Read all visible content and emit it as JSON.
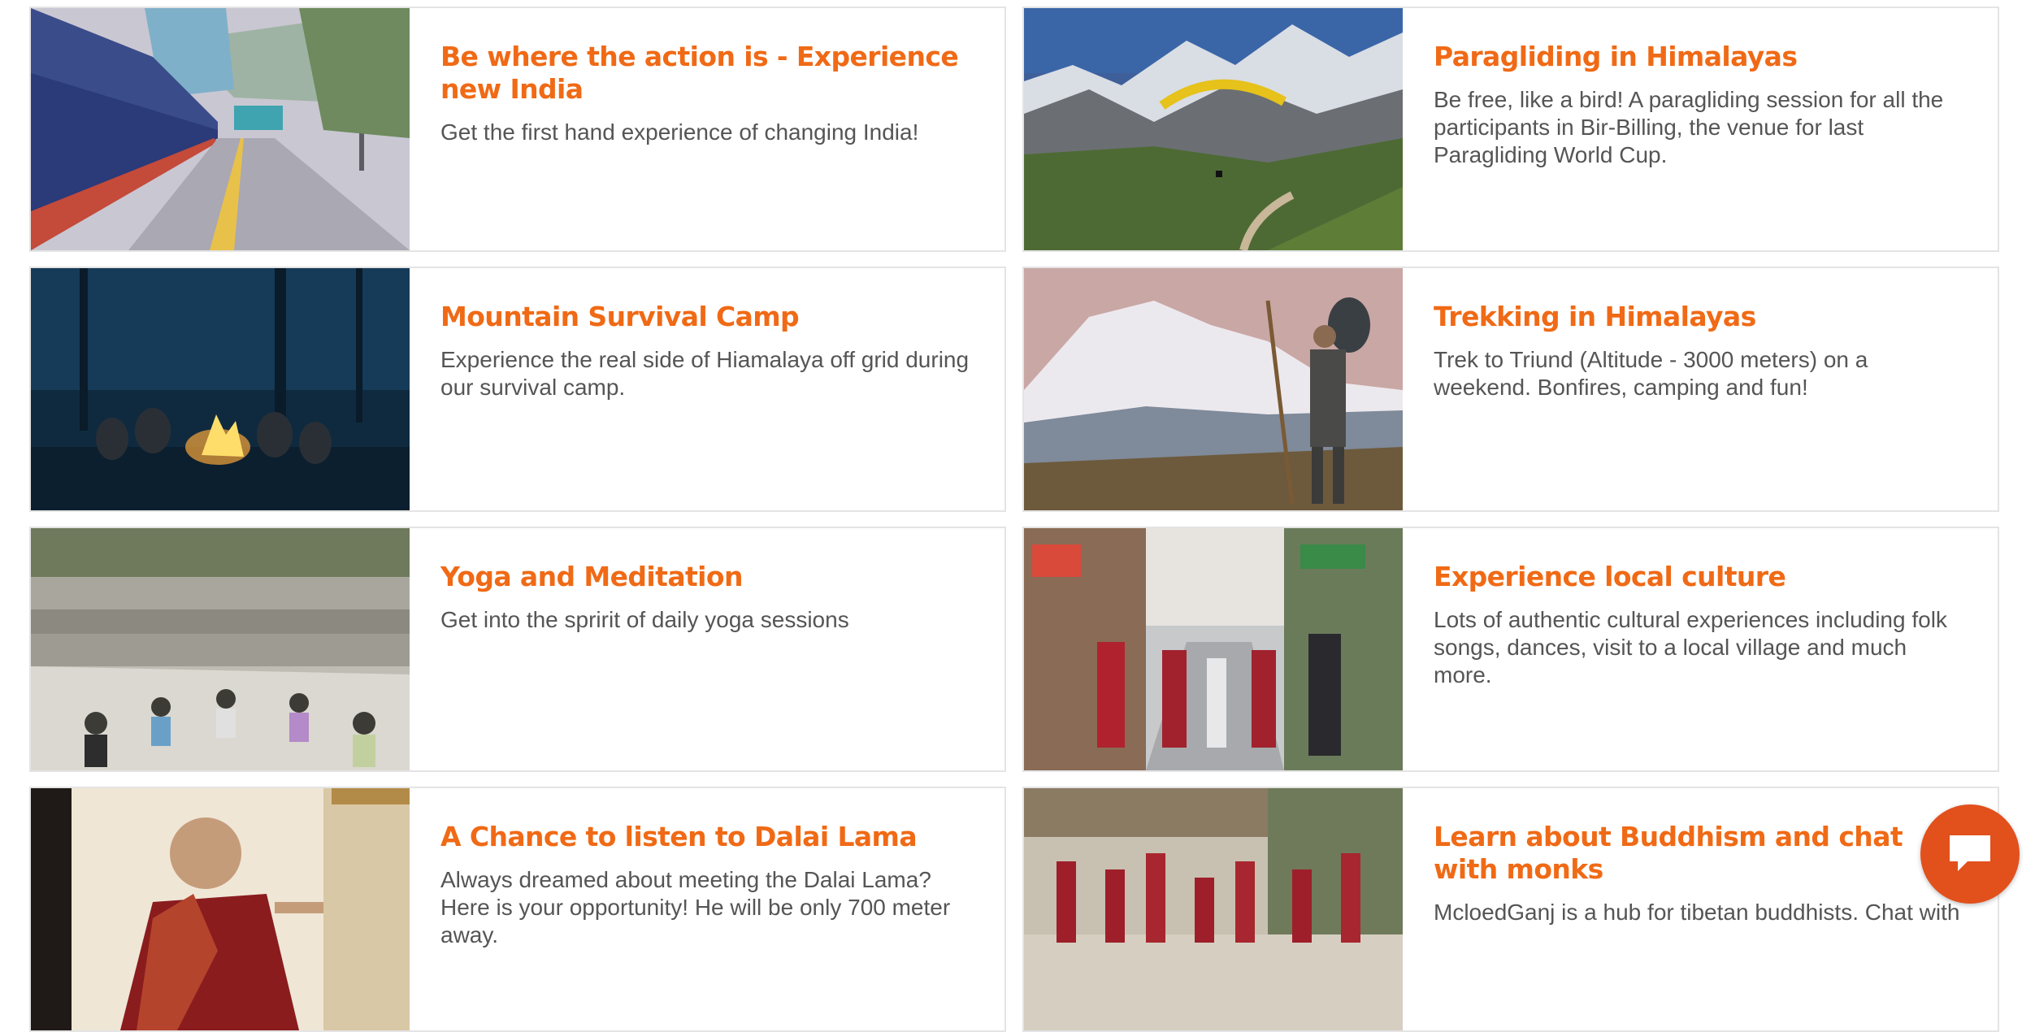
{
  "accent_color": "#f06a16",
  "cards": [
    {
      "title": "Be where the action is - Experience new India",
      "description": "Get the first hand experience of changing India!",
      "image": "railway-platform-photo"
    },
    {
      "title": "Paragliding in Himalayas",
      "description": "Be free, like a bird! A paragliding session for all the participants in Bir-Billing, the venue for last Paragliding World Cup.",
      "image": "paraglider-over-mountains-photo"
    },
    {
      "title": "Mountain Survival Camp",
      "description": "Experience the real side of Hiamalaya off grid during our survival camp.",
      "image": "campfire-in-forest-photo"
    },
    {
      "title": "Trekking in Himalayas",
      "description": "Trek to Triund (Altitude - 3000 meters) on a weekend. Bonfires, camping and fun!",
      "image": "trekker-with-backpack-photo"
    },
    {
      "title": "Yoga and Meditation",
      "description": "Get into the spririt of daily yoga sessions",
      "image": "outdoor-yoga-group-photo"
    },
    {
      "title": "Experience local culture",
      "description": "Lots of authentic cultural experiences including folk songs, dances, visit to a local village and much more.",
      "image": "busy-market-street-photo"
    },
    {
      "title": "A Chance to listen to Dalai Lama",
      "description": "Always dreamed about meeting the Dalai Lama? Here is your opportunity! He will be only 700 meter away.",
      "image": "dalai-lama-photo"
    },
    {
      "title": "Learn about Buddhism and chat with monks",
      "description": "McloedGanj is a hub for tibetan buddhists. Chat with",
      "image": "monks-courtyard-photo"
    }
  ],
  "chat_widget": {
    "icon": "chat-bubble-icon",
    "color": "#e2501c"
  }
}
